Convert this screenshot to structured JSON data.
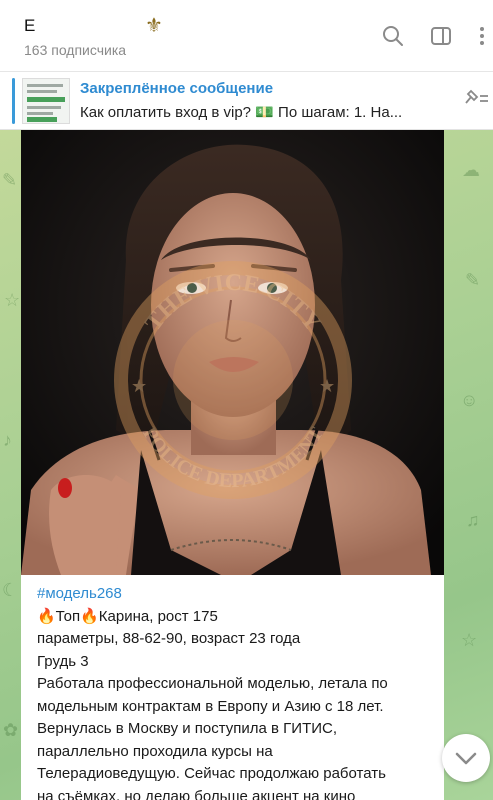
{
  "header": {
    "title": "E",
    "emblem": "⚜",
    "subscribers": "163 подписчика",
    "icons": [
      "search-icon",
      "sidebar-toggle-icon",
      "more-vertical-icon"
    ]
  },
  "pinned": {
    "title": "Закреплённое сообщение",
    "text": "Как оплатить вход в vip? 💵 По шагам:  1. На..."
  },
  "post": {
    "watermark_text_top": "THE VICE CITY",
    "watermark_text_bottom": "POLICE DEPARTMENT",
    "caption": {
      "hashtag": "#модель268",
      "line1": "🔥Топ🔥Карина, рост 175",
      "line2": "параметры, 88-62-90, возраст 23 года",
      "line3": "Грудь 3",
      "line4": "Работала профессиональной моделью, летала по",
      "line5": "модельным контрактам в Европу и Азию с 18 лет.",
      "line6": "Вернулась в Москву и поступила в ГИТИС,",
      "line7": "параллельно проходила курсы на",
      "line8": "Телерадиоведущую. Сейчас продолжаю работать",
      "line9": "на съёмках, но делаю больше акцент на кино"
    }
  },
  "colors": {
    "accent": "#2f8bd1",
    "chat_bg": "#a8cf93"
  }
}
